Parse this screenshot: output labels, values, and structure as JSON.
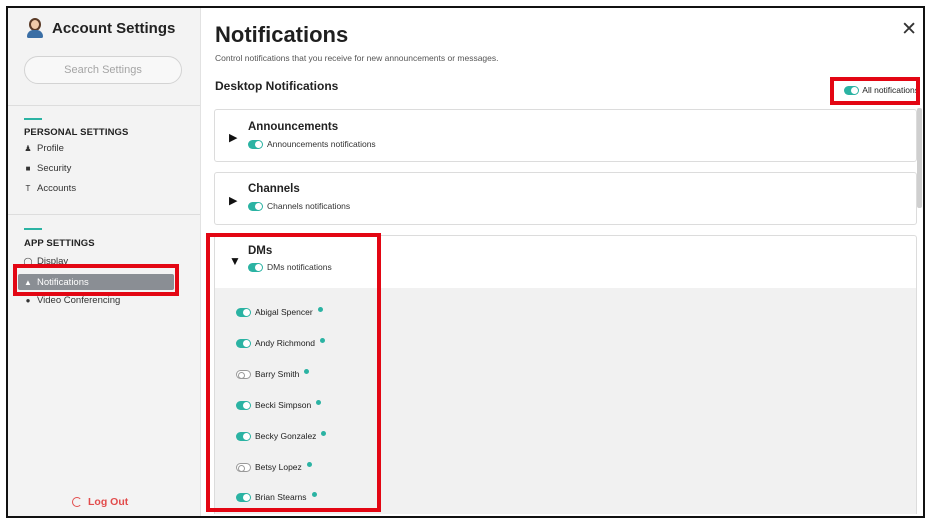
{
  "sidebar": {
    "app_title": "Account Settings",
    "search_placeholder": "Search Settings",
    "personal_title": "PERSONAL SETTINGS",
    "personal_items": [
      {
        "icon": "user-icon",
        "label": "Profile"
      },
      {
        "icon": "lock-icon",
        "label": "Security"
      },
      {
        "icon": "t-icon",
        "label": "Accounts"
      }
    ],
    "app_title_section": "APP SETTINGS",
    "app_items": [
      {
        "icon": "display-icon",
        "label": "Display"
      },
      {
        "icon": "bell-icon",
        "label": "Notifications",
        "active": true
      },
      {
        "icon": "video-icon",
        "label": "Video Conferencing"
      }
    ],
    "logout_label": "Log Out"
  },
  "main": {
    "title": "Notifications",
    "description": "Control notifications that you receive for new announcements or messages.",
    "section_title": "Desktop Notifications",
    "all_notifications": {
      "label": "All notifications",
      "on": true
    },
    "close_icon": "close-icon",
    "groups": [
      {
        "name": "Announcements",
        "toggle_label": "Announcements notifications",
        "on": true,
        "expanded": false
      },
      {
        "name": "Channels",
        "toggle_label": "Channels notifications",
        "on": true,
        "expanded": false
      },
      {
        "name": "DMs",
        "toggle_label": "DMs notifications",
        "on": true,
        "expanded": true
      }
    ],
    "dms": [
      {
        "name": "Abigal Spencer",
        "on": true
      },
      {
        "name": "Andy Richmond",
        "on": true
      },
      {
        "name": "Barry Smith",
        "on": false
      },
      {
        "name": "Becki Simpson",
        "on": true
      },
      {
        "name": "Becky Gonzalez",
        "on": true
      },
      {
        "name": "Betsy Lopez",
        "on": false
      },
      {
        "name": "Brian Stearns",
        "on": true
      }
    ]
  },
  "colors": {
    "accent": "#2bb3a3",
    "highlight": "#e30613",
    "logout": "#e24b4b",
    "active_nav": "#8a8e94"
  }
}
